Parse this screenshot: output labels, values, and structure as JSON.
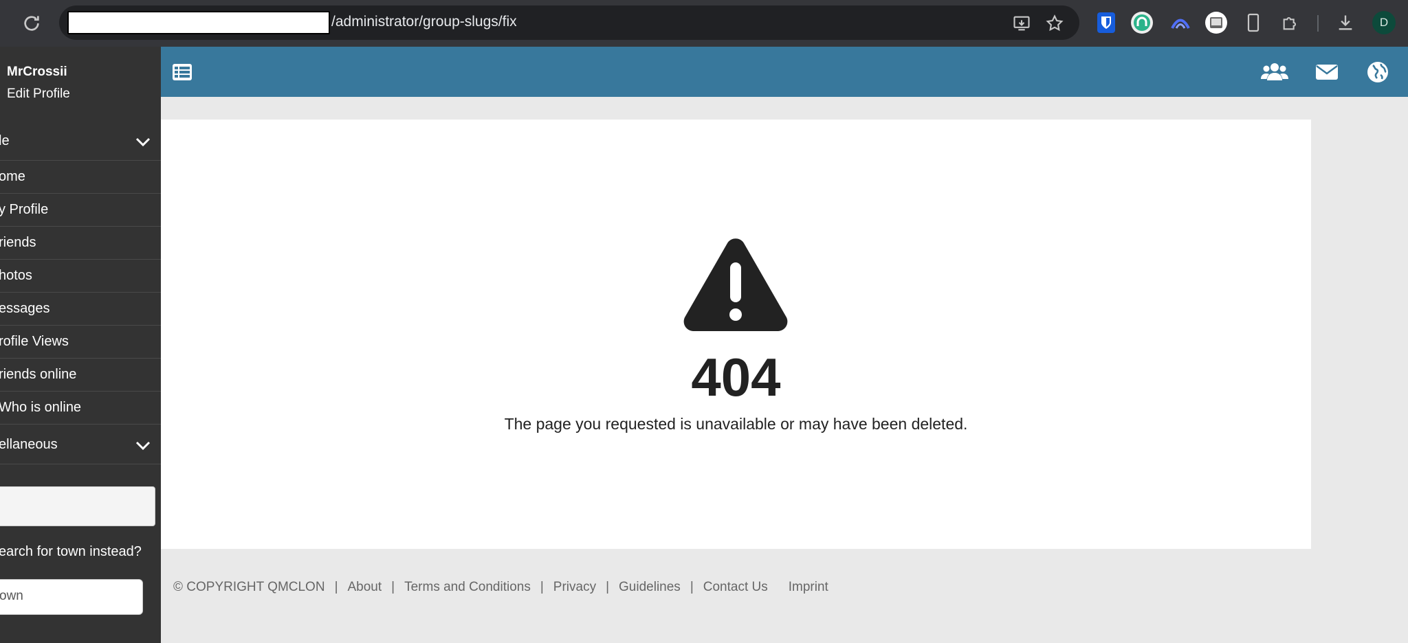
{
  "browser": {
    "url": "/administrator/group-slugs/fix",
    "profile_initial": "D"
  },
  "sidebar": {
    "username": "MrCrossii",
    "edit_profile": "Edit Profile",
    "section_profile": "le",
    "items": [
      {
        "label": "ome"
      },
      {
        "label": "y Profile"
      },
      {
        "label": "riends"
      },
      {
        "label": "hotos"
      },
      {
        "label": "essages"
      },
      {
        "label": "rofile Views"
      },
      {
        "label": "riends online"
      },
      {
        "label": "Who is online"
      }
    ],
    "section_misc": "ellaneous",
    "town_question": "earch for town instead?",
    "town_input_value": "own"
  },
  "error": {
    "code": "404",
    "message": "The page you requested is unavailable or may have been deleted."
  },
  "footer": {
    "copyright": "© COPYRIGHT QMCLON",
    "links": [
      "About",
      "Terms and Conditions",
      "Privacy",
      "Guidelines",
      "Contact Us",
      "Imprint"
    ]
  },
  "colors": {
    "topbar": "#38789c",
    "sidebar": "#333333",
    "background": "#e9e9e9"
  }
}
